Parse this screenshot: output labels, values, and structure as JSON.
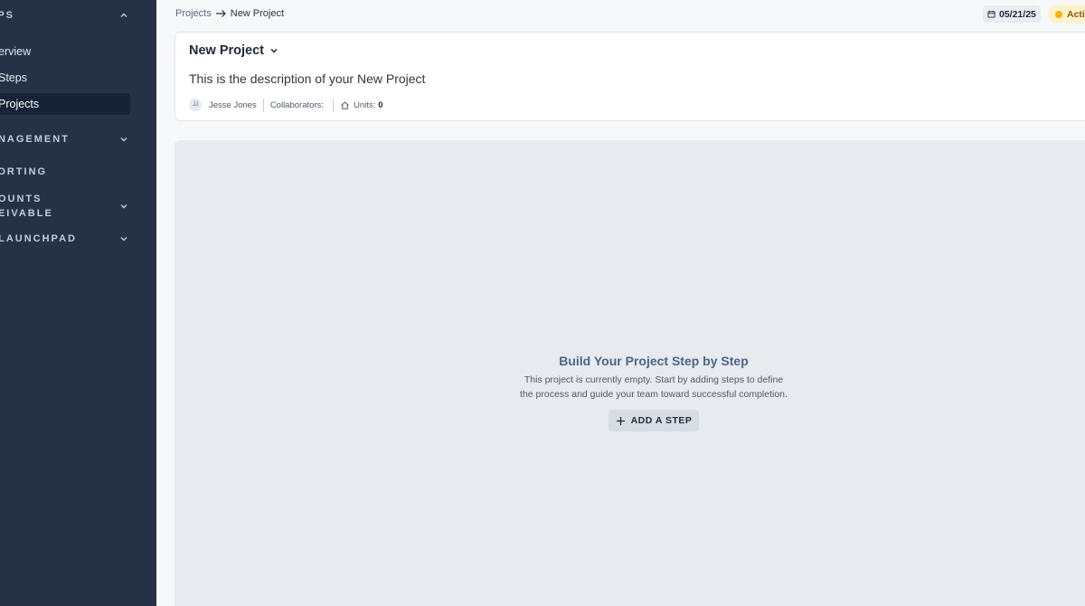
{
  "sidebar": {
    "sections": [
      {
        "label": "EPS",
        "chevron": "chevron-up-icon"
      },
      {
        "label": "ANAGEMENT",
        "chevron": "chevron-down-icon"
      },
      {
        "label": "PORTING"
      },
      {
        "label": "COUNTS\nCEIVABLE",
        "chevron": "chevron-down-icon"
      },
      {
        "label": "/ LAUNCHPAD",
        "chevron": "chevron-down-icon"
      }
    ],
    "items": [
      {
        "label": "erview"
      },
      {
        "label": "Steps"
      },
      {
        "label": "Projects",
        "active": true
      }
    ]
  },
  "breadcrumb": {
    "parent": "Projects",
    "current": "New Project"
  },
  "header_chips": {
    "date": "05/21/25",
    "status": "Acti",
    "status_color": "#f4b400"
  },
  "project": {
    "title": "New Project",
    "description": "This is the description of your New Project",
    "owner_initials": "JJ",
    "owner_name": "Jesse Jones",
    "collaborators_label": "Collaborators:",
    "units_label": "Units:",
    "units_value": "0"
  },
  "empty_state": {
    "title": "Build Your Project Step by Step",
    "text": "This project is currently empty. Start by adding steps to define the process and guide your team toward successful completion.",
    "button_label": "ADD A STEP"
  }
}
